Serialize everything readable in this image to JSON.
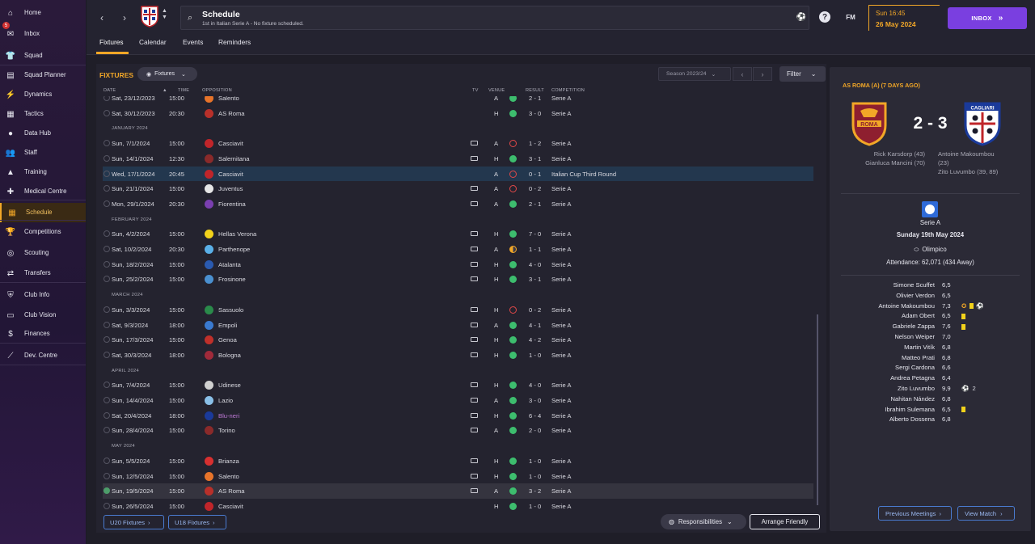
{
  "sidebar": {
    "items": [
      {
        "label": "Home",
        "icon": "home-icon",
        "glyph": "⌂"
      },
      {
        "label": "Inbox",
        "icon": "inbox-icon",
        "glyph": "✉",
        "badge": "5"
      },
      {
        "label": "Squad",
        "icon": "shirt-icon",
        "glyph": "👕"
      },
      {
        "label": "Squad Planner",
        "icon": "planner-icon",
        "glyph": "▤"
      },
      {
        "label": "Dynamics",
        "icon": "dynamics-icon",
        "glyph": "⚡"
      },
      {
        "label": "Tactics",
        "icon": "tactics-icon",
        "glyph": "▦"
      },
      {
        "label": "Data Hub",
        "icon": "data-hub-icon",
        "glyph": "●"
      },
      {
        "label": "Staff",
        "icon": "staff-icon",
        "glyph": "👥"
      },
      {
        "label": "Training",
        "icon": "training-icon",
        "glyph": "▲"
      },
      {
        "label": "Medical Centre",
        "icon": "medical-icon",
        "glyph": "✚"
      },
      {
        "label": "Schedule",
        "icon": "calendar-icon",
        "glyph": "▦"
      },
      {
        "label": "Competitions",
        "icon": "trophy-icon",
        "glyph": "🏆"
      },
      {
        "label": "Scouting",
        "icon": "scouting-icon",
        "glyph": "◎"
      },
      {
        "label": "Transfers",
        "icon": "transfers-icon",
        "glyph": "⇄"
      },
      {
        "label": "Club Info",
        "icon": "club-info-icon",
        "glyph": "⛨"
      },
      {
        "label": "Club Vision",
        "icon": "club-vision-icon",
        "glyph": "▭"
      },
      {
        "label": "Finances",
        "icon": "finances-icon",
        "glyph": "$"
      },
      {
        "label": "Dev. Centre",
        "icon": "dev-centre-icon",
        "glyph": "⟋"
      }
    ]
  },
  "header": {
    "title": "Schedule",
    "subtitle": "1st in Italian Serie A - No fixture scheduled.",
    "date_line1": "Sun 16:45",
    "date_line2": "26 May 2024",
    "inbox_label": "INBOX",
    "fm_label": "FM"
  },
  "tabs": [
    "Fixtures",
    "Calendar",
    "Events",
    "Reminders"
  ],
  "fixtures": {
    "title": "FIXTURES",
    "dropdown": "Fixtures",
    "season": "Season 2023/24",
    "filter": "Filter",
    "headers": {
      "date": "DATE",
      "time": "TIME",
      "opposition": "OPPOSITION",
      "tv": "TV",
      "venue": "VENUE",
      "result": "RESULT",
      "competition": "COMPETITION"
    },
    "rows": [
      {
        "type": "match",
        "date": "Sat, 23/12/2023",
        "time": "15:00",
        "opp": "Salento",
        "tv": false,
        "venue": "A",
        "res": "W",
        "score": "2 - 1",
        "comp": "Serie A",
        "color": "#e8742a"
      },
      {
        "type": "match",
        "date": "Sat, 30/12/2023",
        "time": "20:30",
        "opp": "AS Roma",
        "tv": false,
        "venue": "H",
        "res": "W",
        "score": "3 - 0",
        "comp": "Serie A",
        "color": "#b8302a"
      },
      {
        "type": "month",
        "label": "JANUARY 2024"
      },
      {
        "type": "match",
        "date": "Sun, 7/1/2024",
        "time": "15:00",
        "opp": "Casciavit",
        "tv": true,
        "venue": "A",
        "res": "L",
        "score": "1 - 2",
        "comp": "Serie A",
        "color": "#c0252a"
      },
      {
        "type": "match",
        "date": "Sun, 14/1/2024",
        "time": "12:30",
        "opp": "Salernitana",
        "tv": true,
        "venue": "H",
        "res": "W",
        "score": "3 - 1",
        "comp": "Serie A",
        "color": "#8a2a2a"
      },
      {
        "type": "match",
        "date": "Wed, 17/1/2024",
        "time": "20:45",
        "opp": "Casciavit",
        "tv": false,
        "venue": "A",
        "res": "L",
        "score": "0 - 1",
        "comp": "Italian Cup Third Round",
        "color": "#c0252a",
        "hl": true
      },
      {
        "type": "match",
        "date": "Sun, 21/1/2024",
        "time": "15:00",
        "opp": "Juventus",
        "tv": true,
        "venue": "A",
        "res": "L",
        "score": "0 - 2",
        "comp": "Serie A",
        "color": "#e6e6e6"
      },
      {
        "type": "match",
        "date": "Mon, 29/1/2024",
        "time": "20:30",
        "opp": "Fiorentina",
        "tv": true,
        "venue": "A",
        "res": "W",
        "score": "2 - 1",
        "comp": "Serie A",
        "color": "#7a3fb0"
      },
      {
        "type": "month",
        "label": "FEBRUARY 2024"
      },
      {
        "type": "match",
        "date": "Sun, 4/2/2024",
        "time": "15:00",
        "opp": "Hellas Verona",
        "tv": true,
        "venue": "H",
        "res": "W",
        "score": "7 - 0",
        "comp": "Serie A",
        "color": "#f2d21b"
      },
      {
        "type": "match",
        "date": "Sat, 10/2/2024",
        "time": "20:30",
        "opp": "Parthenope",
        "tv": true,
        "venue": "A",
        "res": "D",
        "score": "1 - 1",
        "comp": "Serie A",
        "color": "#5ab0e8"
      },
      {
        "type": "match",
        "date": "Sun, 18/2/2024",
        "time": "15:00",
        "opp": "Atalanta",
        "tv": true,
        "venue": "H",
        "res": "W",
        "score": "4 - 0",
        "comp": "Serie A",
        "color": "#2a5ab0"
      },
      {
        "type": "match",
        "date": "Sun, 25/2/2024",
        "time": "15:00",
        "opp": "Frosinone",
        "tv": true,
        "venue": "H",
        "res": "W",
        "score": "3 - 1",
        "comp": "Serie A",
        "color": "#4a90d0"
      },
      {
        "type": "month",
        "label": "MARCH 2024"
      },
      {
        "type": "match",
        "date": "Sun, 3/3/2024",
        "time": "15:00",
        "opp": "Sassuolo",
        "tv": true,
        "venue": "H",
        "res": "L",
        "score": "0 - 2",
        "comp": "Serie A",
        "color": "#2a8a4a"
      },
      {
        "type": "match",
        "date": "Sat, 9/3/2024",
        "time": "18:00",
        "opp": "Empoli",
        "tv": true,
        "venue": "A",
        "res": "W",
        "score": "4 - 1",
        "comp": "Serie A",
        "color": "#3a7ad0"
      },
      {
        "type": "match",
        "date": "Sun, 17/3/2024",
        "time": "15:00",
        "opp": "Genoa",
        "tv": true,
        "venue": "H",
        "res": "W",
        "score": "4 - 2",
        "comp": "Serie A",
        "color": "#c0302a"
      },
      {
        "type": "match",
        "date": "Sat, 30/3/2024",
        "time": "18:00",
        "opp": "Bologna",
        "tv": true,
        "venue": "H",
        "res": "W",
        "score": "1 - 0",
        "comp": "Serie A",
        "color": "#a02a3a"
      },
      {
        "type": "month",
        "label": "APRIL 2024"
      },
      {
        "type": "match",
        "date": "Sun, 7/4/2024",
        "time": "15:00",
        "opp": "Udinese",
        "tv": true,
        "venue": "H",
        "res": "W",
        "score": "4 - 0",
        "comp": "Serie A",
        "color": "#d0d0d0"
      },
      {
        "type": "match",
        "date": "Sun, 14/4/2024",
        "time": "15:00",
        "opp": "Lazio",
        "tv": true,
        "venue": "A",
        "res": "W",
        "score": "3 - 0",
        "comp": "Serie A",
        "color": "#8ac0e8"
      },
      {
        "type": "match",
        "date": "Sat, 20/4/2024",
        "time": "18:00",
        "opp": "Blu-neri",
        "tv": true,
        "venue": "H",
        "res": "W",
        "score": "6 - 4",
        "comp": "Serie A",
        "color": "#1a3a9a",
        "oppcolor": "#c07ad8"
      },
      {
        "type": "match",
        "date": "Sun, 28/4/2024",
        "time": "15:00",
        "opp": "Torino",
        "tv": true,
        "venue": "A",
        "res": "W",
        "score": "2 - 0",
        "comp": "Serie A",
        "color": "#8a2a2a"
      },
      {
        "type": "month",
        "label": "MAY 2024"
      },
      {
        "type": "match",
        "date": "Sun, 5/5/2024",
        "time": "15:00",
        "opp": "Brianza",
        "tv": true,
        "venue": "H",
        "res": "W",
        "score": "1 - 0",
        "comp": "Serie A",
        "color": "#d83030"
      },
      {
        "type": "match",
        "date": "Sun, 12/5/2024",
        "time": "15:00",
        "opp": "Salento",
        "tv": true,
        "venue": "H",
        "res": "W",
        "score": "1 - 0",
        "comp": "Serie A",
        "color": "#e8742a"
      },
      {
        "type": "match",
        "date": "Sun, 19/5/2024",
        "time": "15:00",
        "opp": "AS Roma",
        "tv": true,
        "venue": "A",
        "res": "W",
        "score": "3 - 2",
        "comp": "Serie A",
        "color": "#b8302a",
        "cur": true,
        "done": true
      },
      {
        "type": "match",
        "date": "Sun, 26/5/2024",
        "time": "15:00",
        "opp": "Casciavit",
        "tv": false,
        "venue": "H",
        "res": "W",
        "score": "1 - 0",
        "comp": "Serie A",
        "color": "#c0252a"
      }
    ],
    "u20": "U20 Fixtures",
    "u18": "U18 Fixtures",
    "responsibilities": "Responsibilities",
    "arrange_friendly": "Arrange Friendly"
  },
  "match": {
    "title": "AS ROMA (A) (7 DAYS AGO)",
    "score": "2 - 3",
    "home_scorers": [
      "Rick Karsdorp (43)",
      "Gianluca Mancini (70)"
    ],
    "away_scorers": [
      "Antoine Makoumbou",
      "(23)",
      "Zito Luvumbo (39, 89)"
    ],
    "competition": "Serie A",
    "date": "Sunday 19th May 2024",
    "stadium": "Olimpico",
    "attendance": "Attendance: 62,071 (434 Away)",
    "home_crest_text": "ROMA",
    "away_crest_text": "CAGLIARI",
    "players": [
      {
        "name": "Simone Scuffet",
        "rating": "6,5",
        "ev": ""
      },
      {
        "name": "Olivier Verdon",
        "rating": "6,5",
        "ev": ""
      },
      {
        "name": "Antoine Makoumbou",
        "rating": "7,3",
        "ev": "star-card-ball"
      },
      {
        "name": "Adam Obert",
        "rating": "6,5",
        "ev": "card"
      },
      {
        "name": "Gabriele Zappa",
        "rating": "7,6",
        "ev": "card"
      },
      {
        "name": "Nelson Weiper",
        "rating": "7,0",
        "ev": ""
      },
      {
        "name": "Martin Vitík",
        "rating": "6,8",
        "ev": ""
      },
      {
        "name": "Matteo Prati",
        "rating": "6,8",
        "ev": ""
      },
      {
        "name": "Sergi Cardona",
        "rating": "6,6",
        "ev": ""
      },
      {
        "name": "Andrea Petagna",
        "rating": "6,4",
        "ev": ""
      },
      {
        "name": "Zito Luvumbo",
        "rating": "9,9",
        "ev": "ball2"
      },
      {
        "name": "Nahitan Nández",
        "rating": "6,8",
        "ev": ""
      },
      {
        "name": "Ibrahim Sulemana",
        "rating": "6,5",
        "ev": "card"
      },
      {
        "name": "Alberto Dossena",
        "rating": "6,8",
        "ev": ""
      }
    ],
    "goal_count": "2",
    "prev_meetings": "Previous Meetings",
    "view_match": "View Match"
  }
}
